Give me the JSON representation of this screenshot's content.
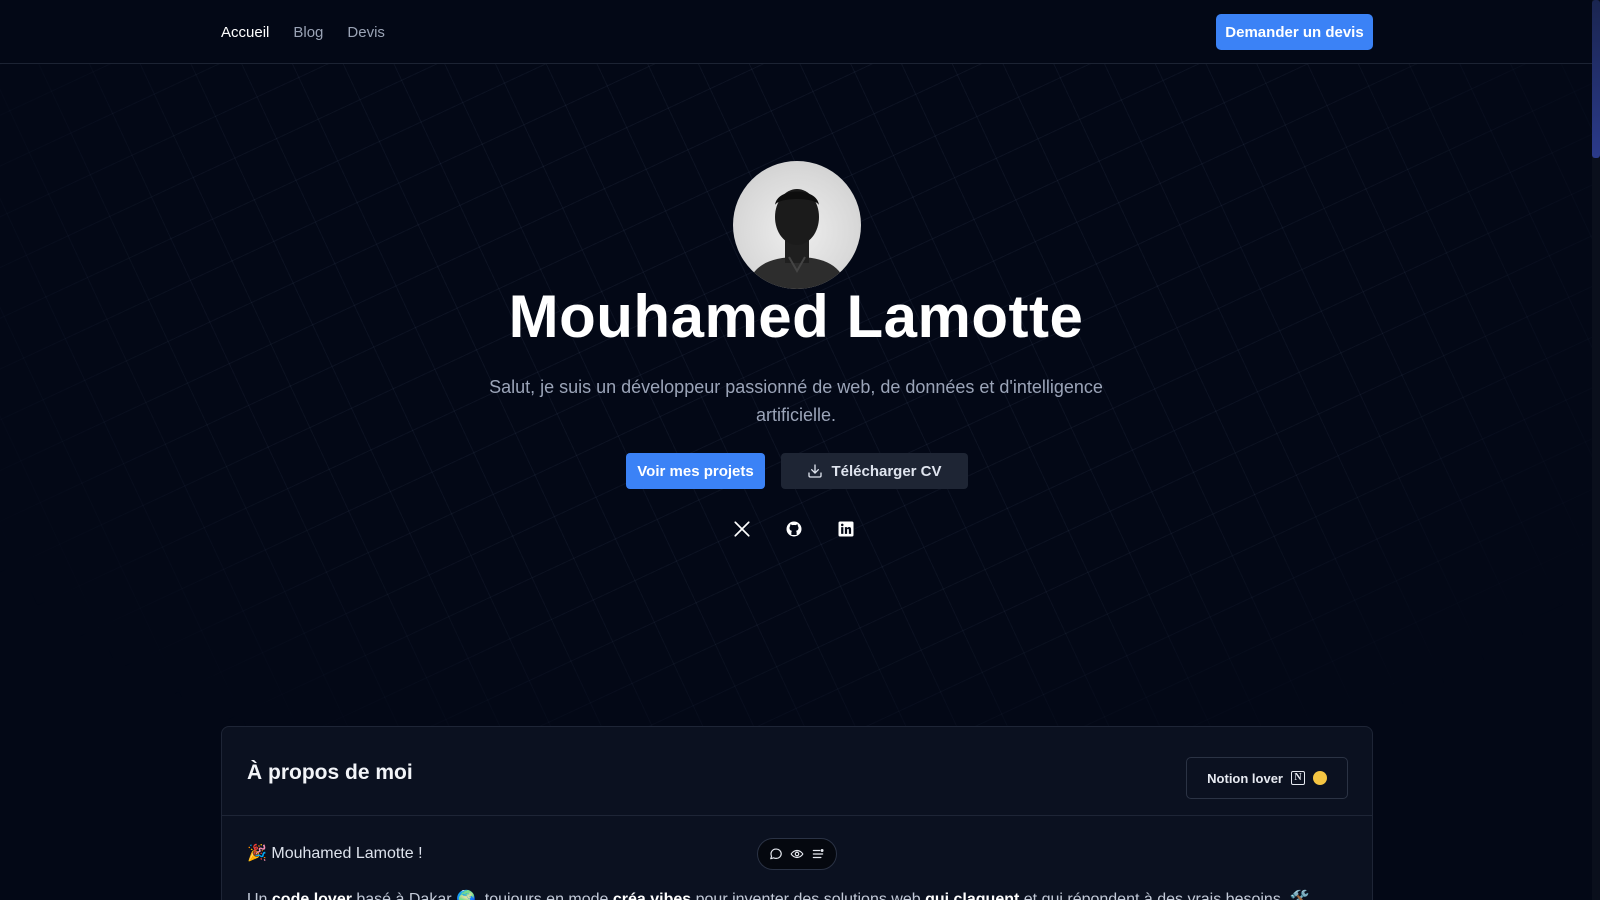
{
  "nav": {
    "items": [
      {
        "label": "Accueil",
        "active": true
      },
      {
        "label": "Blog",
        "active": false
      },
      {
        "label": "Devis",
        "active": false
      }
    ],
    "cta_label": "Demander un devis"
  },
  "hero": {
    "name": "Mouhamed Lamotte",
    "subtitle": "Salut, je suis un développeur passionné de web, de données et d'intelligence artificielle.",
    "primary_button": "Voir mes projets",
    "secondary_button": "Télécharger CV",
    "socials": [
      "x-icon",
      "github-icon",
      "linkedin-icon"
    ]
  },
  "about": {
    "title": "À propos de moi",
    "badge": "Notion lover",
    "greeting": "🎉 Mouhamed Lamotte !",
    "intro": {
      "p1": "Un ",
      "b1": "code lover",
      "p2": " basé à Dakar 🌍, toujours en mode ",
      "b2": "créa vibes",
      "p3": " pour inventer des solutions web ",
      "b3": "qui claquent",
      "p4": " et qui répondent à des vrais besoins. 🛠️"
    }
  },
  "colors": {
    "background": "#030816",
    "accent": "#3b82f6",
    "card": "#0b1120"
  },
  "toolbar": {
    "icons": [
      "comment-icon",
      "eye-icon",
      "list-icon"
    ]
  }
}
